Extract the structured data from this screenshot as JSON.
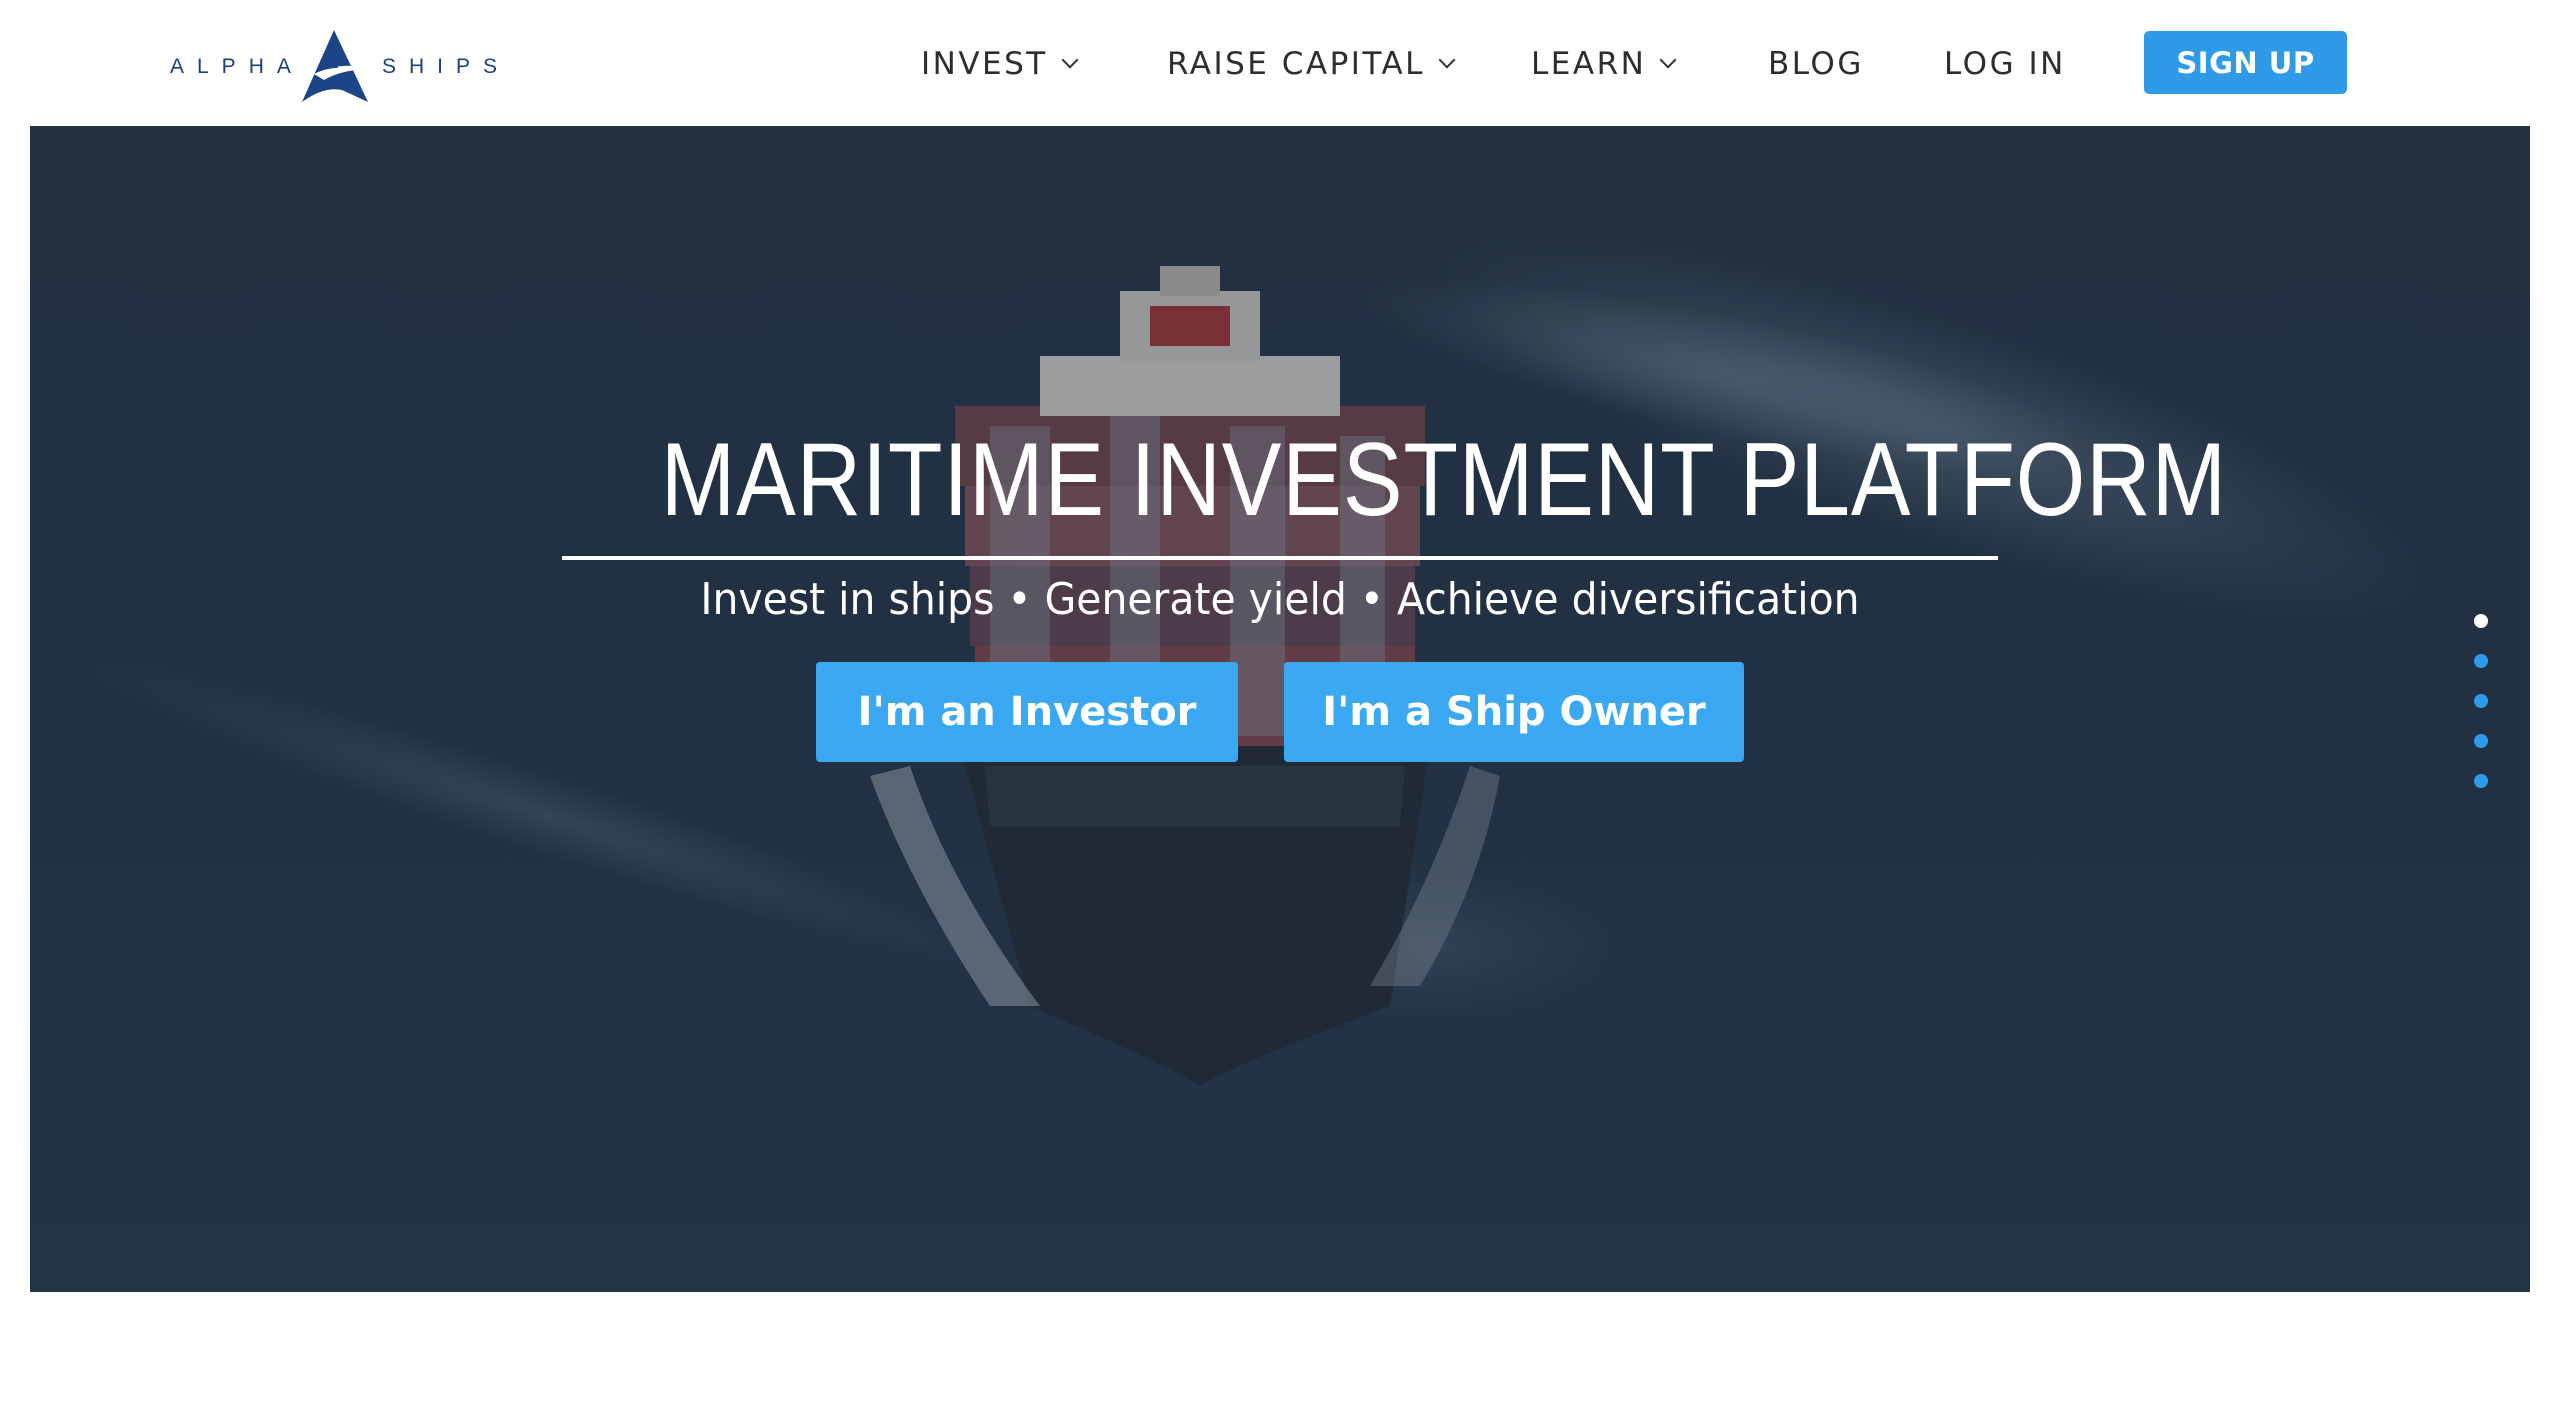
{
  "header": {
    "logo": {
      "left_text": "ALPHA",
      "right_text": "SHIPS",
      "brand_color": "#1d3f7a"
    },
    "nav": {
      "items": [
        {
          "label": "INVEST",
          "has_dropdown": true
        },
        {
          "label": "RAISE CAPITAL",
          "has_dropdown": true
        },
        {
          "label": "LEARN",
          "has_dropdown": true
        },
        {
          "label": "BLOG",
          "has_dropdown": false
        },
        {
          "label": "LOG IN",
          "has_dropdown": false
        }
      ],
      "signup_label": "SIGN UP",
      "accent_color": "#2f9be8"
    }
  },
  "hero": {
    "title": "MARITIME INVESTMENT PLATFORM",
    "subtitle": "Invest in ships • Generate yield • Achieve diversification",
    "buttons": {
      "investor": "I'm an Investor",
      "ship_owner": "I'm a Ship Owner"
    },
    "button_color": "#3aa8f2",
    "slides": {
      "count": 5,
      "active_index": 0
    }
  }
}
